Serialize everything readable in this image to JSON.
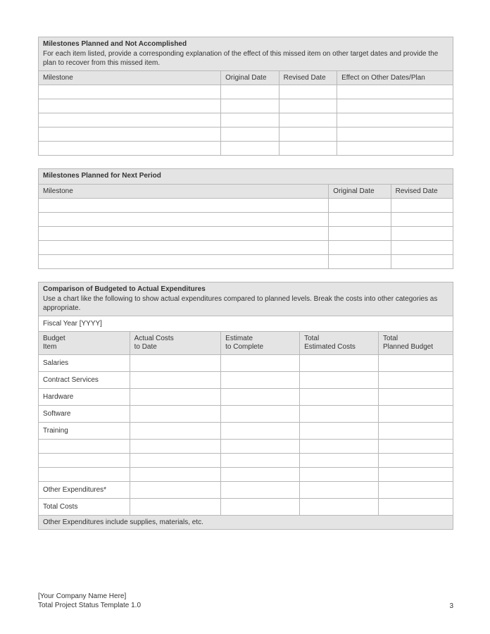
{
  "section1": {
    "title": "Milestones Planned and Not Accomplished",
    "desc": "For each item listed, provide a corresponding explanation of the effect of this missed item on other target dates and provide the plan to recover from this missed item.",
    "cols": [
      "Milestone",
      "Original Date",
      "Revised Date",
      "Effect on Other Dates/Plan"
    ],
    "rows": [
      [
        "",
        "",
        "",
        ""
      ],
      [
        "",
        "",
        "",
        ""
      ],
      [
        "",
        "",
        "",
        ""
      ],
      [
        "",
        "",
        "",
        ""
      ],
      [
        "",
        "",
        "",
        ""
      ]
    ]
  },
  "section2": {
    "title": "Milestones Planned for Next Period",
    "cols": [
      "Milestone",
      "Original Date",
      "Revised Date"
    ],
    "rows": [
      [
        "",
        "",
        ""
      ],
      [
        "",
        "",
        ""
      ],
      [
        "",
        "",
        ""
      ],
      [
        "",
        "",
        ""
      ],
      [
        "",
        "",
        ""
      ]
    ]
  },
  "section3": {
    "title": "Comparison of Budgeted to Actual Expenditures",
    "desc": "Use a chart like the following to show actual expenditures compared to planned levels. Break the costs into other categories as appropriate.",
    "fiscalYear": "Fiscal Year [YYYY]",
    "cols": [
      {
        "line1": "Budget",
        "line2": "Item"
      },
      {
        "line1": "Actual Costs",
        "line2": "to Date"
      },
      {
        "line1": "Estimate",
        "line2": "to Complete"
      },
      {
        "line1": "Total",
        "line2": "Estimated Costs"
      },
      {
        "line1": "Total",
        "line2": "Planned Budget"
      }
    ],
    "items": [
      "Salaries",
      "Contract Services",
      "Hardware",
      "Software",
      "Training",
      "",
      "",
      "",
      "Other Expenditures*",
      "Total Costs"
    ],
    "footnote": "Other Expenditures include supplies, materials, etc."
  },
  "footer": {
    "company": "[Your Company Name Here]",
    "template": "Total Project Status Template 1.0",
    "page": "3"
  }
}
